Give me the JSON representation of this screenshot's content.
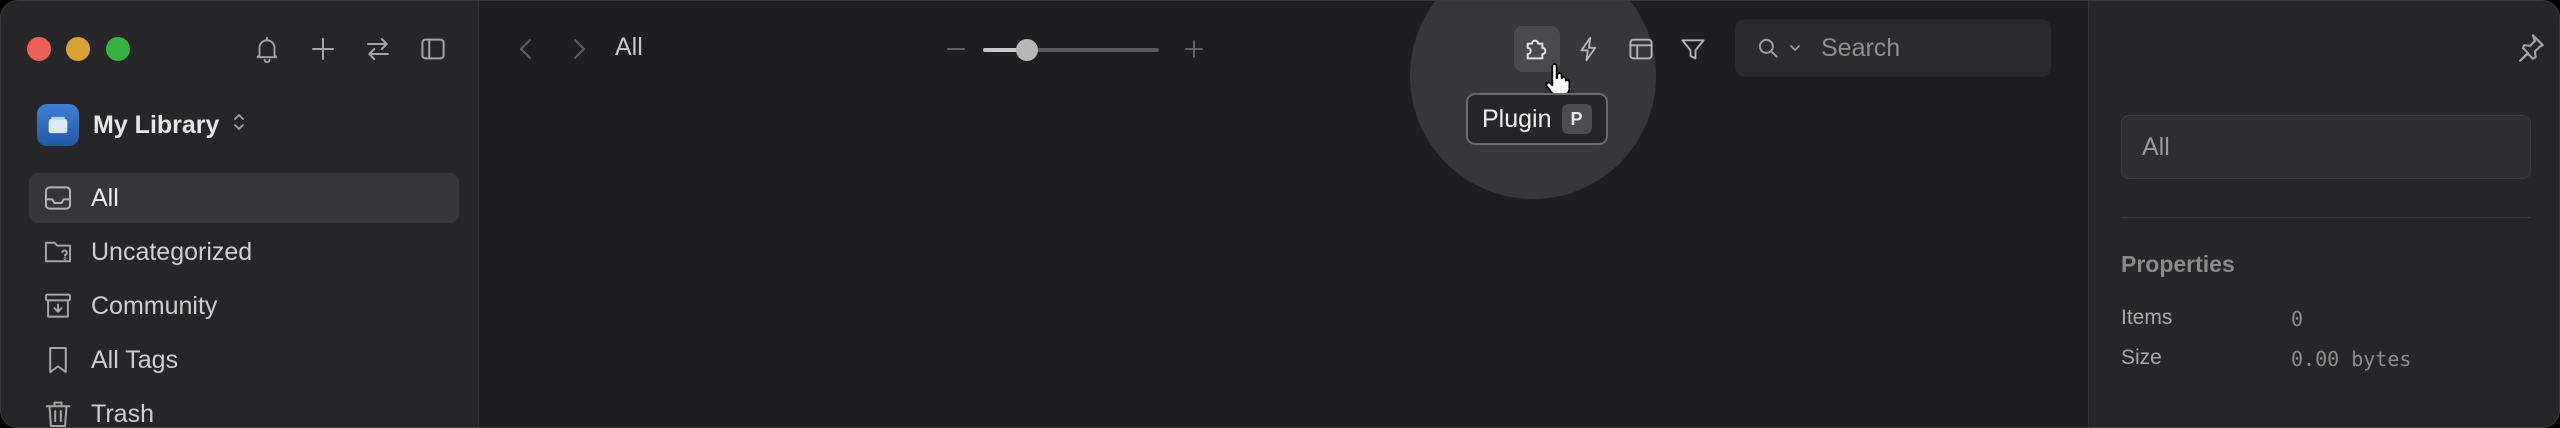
{
  "sidebar": {
    "library_name": "My Library",
    "items": [
      {
        "label": "All",
        "icon": "inbox-icon"
      },
      {
        "label": "Uncategorized",
        "icon": "folder-question-icon"
      },
      {
        "label": "Community",
        "icon": "archive-download-icon"
      },
      {
        "label": "All Tags",
        "icon": "bookmark-icon"
      },
      {
        "label": "Trash",
        "icon": "trash-icon"
      }
    ]
  },
  "toolbar": {
    "breadcrumb": "All",
    "zoom_level": 0.25,
    "tooltip": {
      "label": "Plugin",
      "shortcut": "P"
    },
    "search_placeholder": "Search"
  },
  "inspector": {
    "name_value": "All",
    "properties_title": "Properties",
    "rows": [
      {
        "label": "Items",
        "value": "0"
      },
      {
        "label": "Size",
        "value": "0.00 bytes"
      }
    ]
  }
}
